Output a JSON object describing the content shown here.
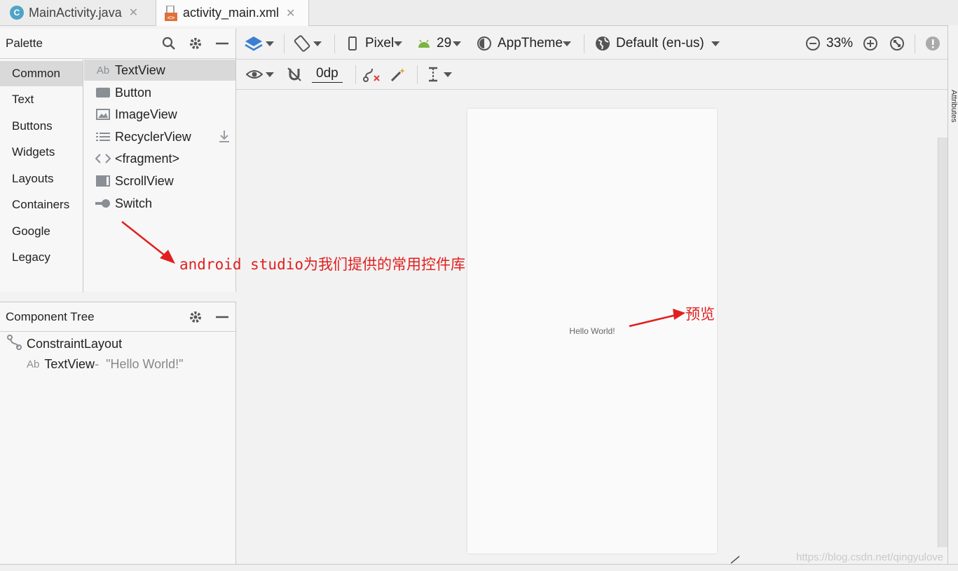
{
  "tabs": [
    {
      "label": "MainActivity.java",
      "icon": "java-class-icon",
      "active": false
    },
    {
      "label": "activity_main.xml",
      "icon": "xml-layout-icon",
      "active": true
    }
  ],
  "palette": {
    "title": "Palette",
    "categories": [
      "Common",
      "Text",
      "Buttons",
      "Widgets",
      "Layouts",
      "Containers",
      "Google",
      "Legacy"
    ],
    "selected_category": "Common",
    "items": [
      {
        "label": "TextView",
        "icon": "textview-icon"
      },
      {
        "label": "Button",
        "icon": "button-icon"
      },
      {
        "label": "ImageView",
        "icon": "imageview-icon"
      },
      {
        "label": "RecyclerView",
        "icon": "recyclerview-icon"
      },
      {
        "label": "<fragment>",
        "icon": "fragment-icon"
      },
      {
        "label": "ScrollView",
        "icon": "scrollview-icon"
      },
      {
        "label": "Switch",
        "icon": "switch-icon"
      }
    ]
  },
  "component_tree": {
    "title": "Component Tree",
    "root": "ConstraintLayout",
    "child": {
      "label": "TextView",
      "separator": "-",
      "text": "\"Hello World!\""
    }
  },
  "toolbar": {
    "device": "Pixel",
    "api": "29",
    "theme": "AppTheme",
    "locale": "Default (en-us)",
    "zoom": "33%",
    "margin": "0dp"
  },
  "preview": {
    "text": "Hello World!"
  },
  "annotations": {
    "palette_note": "android studio为我们提供的常用控件库",
    "preview_note": "预览"
  },
  "watermark": "https://blog.csdn.net/qingyulove",
  "side_label": "Attributes",
  "icon_glyphs": {
    "ab": "Ab",
    "c": "C"
  },
  "colors": {
    "annotation": "#e02020",
    "android_green": "#7cb342",
    "blue_layers": "#3b7fd1"
  }
}
